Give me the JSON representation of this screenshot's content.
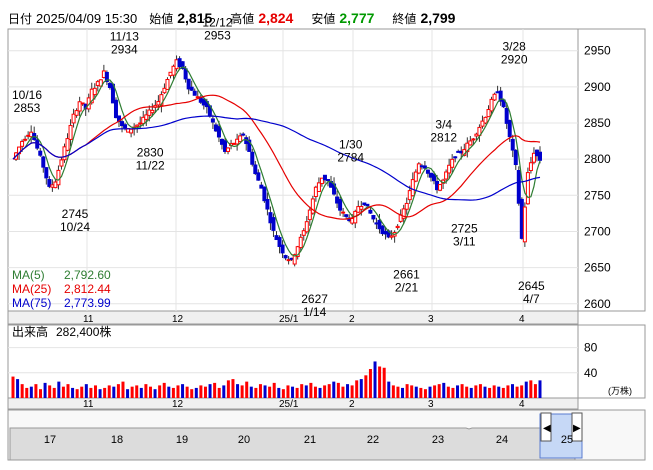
{
  "header": {
    "date_label": "日付",
    "datetime": "2025/04/09 15:30",
    "open_label": "始値",
    "open": "2,815",
    "high_label": "高値",
    "high": "2,824",
    "low_label": "安値",
    "low": "2,777",
    "close_label": "終値",
    "close": "2,799"
  },
  "colors": {
    "up": "#ff0000",
    "down": "#0000cc",
    "ma5": "#2e7d32",
    "ma25": "#e60000",
    "ma75": "#0000cc",
    "volume_up": "#ff0000",
    "volume_down": "#0000cc"
  },
  "chart_data": [
    {
      "type": "candlestick",
      "y_ticks": [
        "2950",
        "2900",
        "2850",
        "2800",
        "2750",
        "2700",
        "2650",
        "2600"
      ],
      "ylim": [
        2590,
        2980
      ],
      "x_ticks": [
        "11",
        "12",
        "25/1",
        "2",
        "3",
        "4"
      ],
      "annotations": [
        {
          "label": "10/16",
          "value": "2853",
          "kind": "high",
          "date": "10/16",
          "price": 2853
        },
        {
          "label": "11/13",
          "value": "2934",
          "kind": "high",
          "date": "11/13",
          "price": 2934
        },
        {
          "label": "12/12",
          "value": "2953",
          "kind": "high",
          "date": "12/12",
          "price": 2953
        },
        {
          "label": "3/4",
          "value": "2812",
          "kind": "high",
          "date": "3/4",
          "price": 2812
        },
        {
          "label": "3/28",
          "value": "2920",
          "kind": "high",
          "date": "3/28",
          "price": 2920
        },
        {
          "label": "10/24",
          "value": "2745",
          "kind": "low",
          "date": "10/24",
          "price": 2745
        },
        {
          "label": "11/22",
          "value": "2830",
          "kind": "low",
          "date": "11/22",
          "price": 2830
        },
        {
          "label": "1/14",
          "value": "2627",
          "kind": "low",
          "date": "1/14",
          "price": 2627
        },
        {
          "label": "1/30",
          "value": "2784",
          "kind": "high",
          "date": "1/30",
          "price": 2784
        },
        {
          "label": "2/21",
          "value": "2661",
          "kind": "low",
          "date": "2/21",
          "price": 2661
        },
        {
          "label": "3/11",
          "value": "2725",
          "kind": "low",
          "date": "3/11",
          "price": 2725
        },
        {
          "label": "4/7",
          "value": "2645",
          "kind": "low",
          "date": "4/7",
          "price": 2645
        }
      ],
      "legend": [
        {
          "name": "MA(5)",
          "value": "2,792.60",
          "color": "#2e7d32"
        },
        {
          "name": "MA(25)",
          "value": "2,812.44",
          "color": "#e60000"
        },
        {
          "name": "MA(75)",
          "value": "2,773.99",
          "color": "#0000cc"
        }
      ],
      "close_path": [
        [
          0,
          2800
        ],
        [
          3,
          2825
        ],
        [
          6,
          2840
        ],
        [
          8,
          2815
        ],
        [
          10,
          2790
        ],
        [
          12,
          2760
        ],
        [
          14,
          2770
        ],
        [
          16,
          2800
        ],
        [
          18,
          2830
        ],
        [
          20,
          2860
        ],
        [
          22,
          2880
        ],
        [
          24,
          2870
        ],
        [
          26,
          2895
        ],
        [
          28,
          2905
        ],
        [
          30,
          2920
        ],
        [
          32,
          2900
        ],
        [
          34,
          2860
        ],
        [
          36,
          2845
        ],
        [
          38,
          2840
        ],
        [
          40,
          2845
        ],
        [
          42,
          2850
        ],
        [
          44,
          2860
        ],
        [
          46,
          2870
        ],
        [
          48,
          2880
        ],
        [
          50,
          2900
        ],
        [
          52,
          2920
        ],
        [
          54,
          2935
        ],
        [
          56,
          2925
        ],
        [
          58,
          2900
        ],
        [
          60,
          2890
        ],
        [
          62,
          2880
        ],
        [
          64,
          2870
        ],
        [
          66,
          2850
        ],
        [
          68,
          2830
        ],
        [
          70,
          2810
        ],
        [
          72,
          2820
        ],
        [
          74,
          2825
        ],
        [
          76,
          2835
        ],
        [
          78,
          2810
        ],
        [
          80,
          2780
        ],
        [
          82,
          2760
        ],
        [
          84,
          2730
        ],
        [
          86,
          2700
        ],
        [
          88,
          2680
        ],
        [
          90,
          2665
        ],
        [
          92,
          2660
        ],
        [
          94,
          2680
        ],
        [
          96,
          2700
        ],
        [
          98,
          2730
        ],
        [
          100,
          2760
        ],
        [
          102,
          2775
        ],
        [
          104,
          2770
        ],
        [
          106,
          2750
        ],
        [
          108,
          2730
        ],
        [
          110,
          2720
        ],
        [
          112,
          2715
        ],
        [
          114,
          2735
        ],
        [
          116,
          2740
        ],
        [
          118,
          2725
        ],
        [
          120,
          2710
        ],
        [
          122,
          2700
        ],
        [
          124,
          2690
        ],
        [
          126,
          2700
        ],
        [
          128,
          2720
        ],
        [
          130,
          2740
        ],
        [
          132,
          2770
        ],
        [
          134,
          2795
        ],
        [
          136,
          2790
        ],
        [
          138,
          2775
        ],
        [
          140,
          2760
        ],
        [
          142,
          2770
        ],
        [
          144,
          2790
        ],
        [
          146,
          2805
        ],
        [
          148,
          2810
        ],
        [
          150,
          2820
        ],
        [
          152,
          2830
        ],
        [
          154,
          2845
        ],
        [
          156,
          2860
        ],
        [
          158,
          2880
        ],
        [
          160,
          2895
        ],
        [
          162,
          2870
        ],
        [
          164,
          2830
        ],
        [
          166,
          2790
        ],
        [
          168,
          2690
        ],
        [
          170,
          2780
        ],
        [
          172,
          2810
        ],
        [
          174,
          2799
        ]
      ],
      "ma5": [
        2792.6
      ],
      "ma25": [
        2812.44
      ],
      "ma75": [
        2773.99
      ]
    },
    {
      "type": "bar",
      "title": "出来高",
      "latest_volume": "282,400株",
      "y_ticks": [
        "80",
        "40"
      ],
      "unit": "(万株)",
      "ylim": [
        0,
        100
      ],
      "values": [
        34,
        30,
        22,
        16,
        18,
        22,
        14,
        24,
        20,
        16,
        26,
        18,
        22,
        16,
        14,
        18,
        22,
        16,
        20,
        14,
        16,
        20,
        18,
        22,
        26,
        14,
        18,
        20,
        16,
        22,
        18,
        14,
        20,
        24,
        18,
        16,
        20,
        22,
        18,
        14,
        16,
        20,
        18,
        22,
        24,
        16,
        20,
        28,
        30,
        22,
        20,
        26,
        18,
        16,
        22,
        20,
        18,
        24,
        16,
        14,
        20,
        18,
        16,
        22,
        20,
        24,
        18,
        16,
        20,
        22,
        26,
        24,
        18,
        22,
        20,
        28,
        30,
        36,
        46,
        58,
        50,
        48,
        26,
        20,
        18,
        16,
        22,
        20,
        18,
        16,
        14,
        18,
        20,
        22,
        24,
        18,
        16,
        20,
        22,
        18,
        16,
        20,
        22,
        18,
        16,
        20,
        18,
        16,
        20,
        22,
        18,
        20,
        26,
        28,
        22,
        28
      ],
      "x_ticks": [
        "11",
        "12",
        "25/1",
        "2",
        "3",
        "4"
      ]
    },
    {
      "type": "area",
      "overview_labels": [
        "17",
        "18",
        "19",
        "20",
        "21",
        "22",
        "23",
        "24",
        "25"
      ]
    }
  ]
}
